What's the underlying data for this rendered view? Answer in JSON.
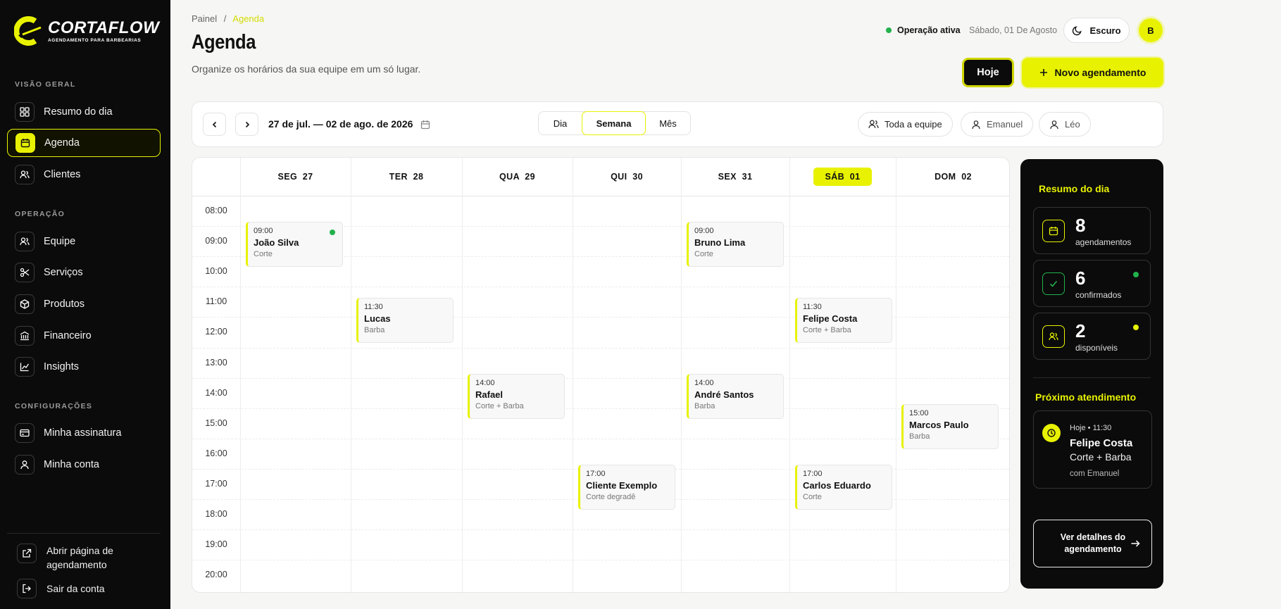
{
  "brand": {
    "name": "CORTAFLOW",
    "tagline": "AGENDAMENTO PARA BARBEARIAS"
  },
  "sidebar": {
    "sections": [
      {
        "title": "VISÃO GERAL",
        "items": [
          {
            "label": "Resumo do dia",
            "icon": "grid-icon"
          },
          {
            "label": "Agenda",
            "icon": "calendar-icon",
            "active": true
          },
          {
            "label": "Clientes",
            "icon": "users-icon"
          }
        ]
      },
      {
        "title": "OPERAÇÃO",
        "items": [
          {
            "label": "Equipe",
            "icon": "team-icon"
          },
          {
            "label": "Serviços",
            "icon": "scissors-icon"
          },
          {
            "label": "Produtos",
            "icon": "box-icon"
          },
          {
            "label": "Financeiro",
            "icon": "bank-icon"
          },
          {
            "label": "Insights",
            "icon": "chart-icon"
          }
        ]
      },
      {
        "title": "CONFIGURAÇÕES",
        "items": [
          {
            "label": "Minha assinatura",
            "icon": "card-icon"
          },
          {
            "label": "Minha conta",
            "icon": "user-icon"
          }
        ]
      }
    ],
    "bottom": {
      "open_page": "Abrir página de agendamento",
      "logout": "Sair da conta"
    }
  },
  "header": {
    "breadcrumb_root": "Painel",
    "breadcrumb_sep": "/",
    "breadcrumb_current": "Agenda",
    "title": "Agenda",
    "subtitle": "Organize os horários da sua equipe em um só lugar.",
    "status": "Operação ativa",
    "date": "Sábado, 01 De Agosto",
    "theme_label": "Escuro",
    "avatar": "B",
    "today_button": "Hoje",
    "new_button": "Novo agendamento",
    "status_color": "#22b14c",
    "accent_color": "#e8f200"
  },
  "toolbar": {
    "range": "27 de jul. — 02 de ago. de 2026",
    "views": [
      "Dia",
      "Semana",
      "Mês"
    ],
    "active_view": "Semana",
    "filters": [
      "Toda a equipe",
      "Emanuel",
      "Léo"
    ]
  },
  "calendar": {
    "days": [
      {
        "label": "SEG  27"
      },
      {
        "label": "TER  28"
      },
      {
        "label": "QUA  29"
      },
      {
        "label": "QUI  30"
      },
      {
        "label": "SEX  31"
      },
      {
        "label": "SÁB  01",
        "today": true
      },
      {
        "label": "DOM  02"
      }
    ],
    "hours": [
      "08:00",
      "09:00",
      "10:00",
      "11:00",
      "12:00",
      "13:00",
      "14:00",
      "15:00",
      "16:00",
      "17:00",
      "18:00",
      "19:00",
      "20:00"
    ],
    "events": [
      {
        "day": 0,
        "time": "09:00",
        "name": "João Silva",
        "service": "Corte",
        "confirmed": true
      },
      {
        "day": 1,
        "time": "11:30",
        "name": "Lucas",
        "service": "Barba"
      },
      {
        "day": 2,
        "time": "14:00",
        "name": "Rafael",
        "service": "Corte + Barba"
      },
      {
        "day": 3,
        "time": "17:00",
        "name": "Cliente Exemplo",
        "service": "Corte degradê"
      },
      {
        "day": 4,
        "time": "09:00",
        "name": "Bruno Lima",
        "service": "Corte"
      },
      {
        "day": 4,
        "time": "14:00",
        "name": "André Santos",
        "service": "Barba"
      },
      {
        "day": 5,
        "time": "11:30",
        "name": "Felipe Costa",
        "service": "Corte + Barba"
      },
      {
        "day": 5,
        "time": "17:00",
        "name": "Carlos Eduardo",
        "service": "Corte"
      },
      {
        "day": 6,
        "time": "15:00",
        "name": "Marcos Paulo",
        "service": "Barba"
      }
    ]
  },
  "summary": {
    "title": "Resumo do dia",
    "stats": [
      {
        "value": "8",
        "label": "agendamentos",
        "icon": "calendar-icon"
      },
      {
        "value": "6",
        "label": "confirmados",
        "icon": "check-icon",
        "dot": "#22b14c"
      },
      {
        "value": "2",
        "label": "disponíveis",
        "icon": "users-icon",
        "dot": "#e8f200"
      }
    ],
    "next_title": "Próximo atendimento",
    "next": {
      "when": "Hoje • 11:30",
      "client": "Felipe Costa",
      "service": "Corte + Barba",
      "with": "com Emanuel"
    },
    "details_button": "Ver detalhes do agendamento"
  }
}
